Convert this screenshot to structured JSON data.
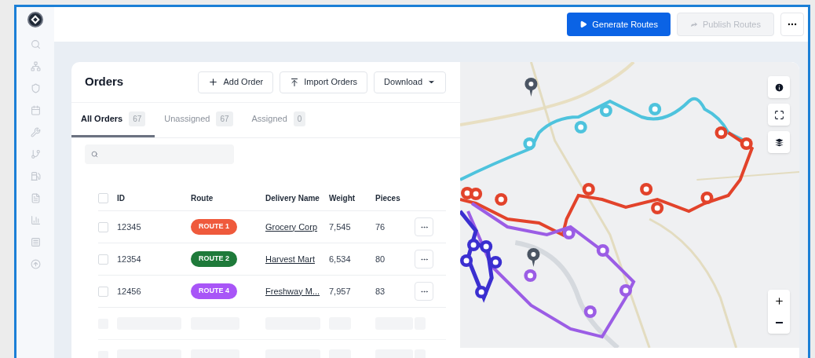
{
  "top_bar": {
    "actions": [
      {
        "label": "Generate Routes",
        "kind": "primary",
        "disabled": false
      },
      {
        "label": "Publish Routes",
        "kind": "share",
        "disabled": true
      }
    ]
  },
  "orders": {
    "title": "Orders",
    "buttons": [
      {
        "label": "Add Order",
        "kind": "add"
      },
      {
        "label": "Import Orders",
        "kind": "import"
      },
      {
        "label": "Download",
        "kind": "dropdown"
      }
    ],
    "tabs": [
      {
        "label": "All Orders",
        "count": "67",
        "selected": true
      },
      {
        "label": "Unassigned",
        "count": "67",
        "selected": false
      },
      {
        "label": "Assigned",
        "count": "0",
        "selected": false
      }
    ],
    "table": {
      "all_checked": false,
      "columns": [
        "ID",
        "Route",
        "Delivery Name",
        "Weight",
        "Pieces"
      ],
      "rows": [
        {
          "id": "12345",
          "route": "ROUTE 1",
          "color": "#ef5a3c",
          "delivery_name": "Grocery Corp",
          "weight": "7,545",
          "pieces": "76",
          "checked": false
        },
        {
          "id": "12354",
          "route": "ROUTE 2",
          "color": "#1e7a3a",
          "delivery_name": "Harvest Mart",
          "weight": "6,534",
          "pieces": "80",
          "checked": false
        },
        {
          "id": "12456",
          "route": "ROUTE 4",
          "color": "#a855f7",
          "delivery_name": "Freshway M...",
          "weight": "7,957",
          "pieces": "83",
          "checked": false
        }
      ]
    }
  }
}
